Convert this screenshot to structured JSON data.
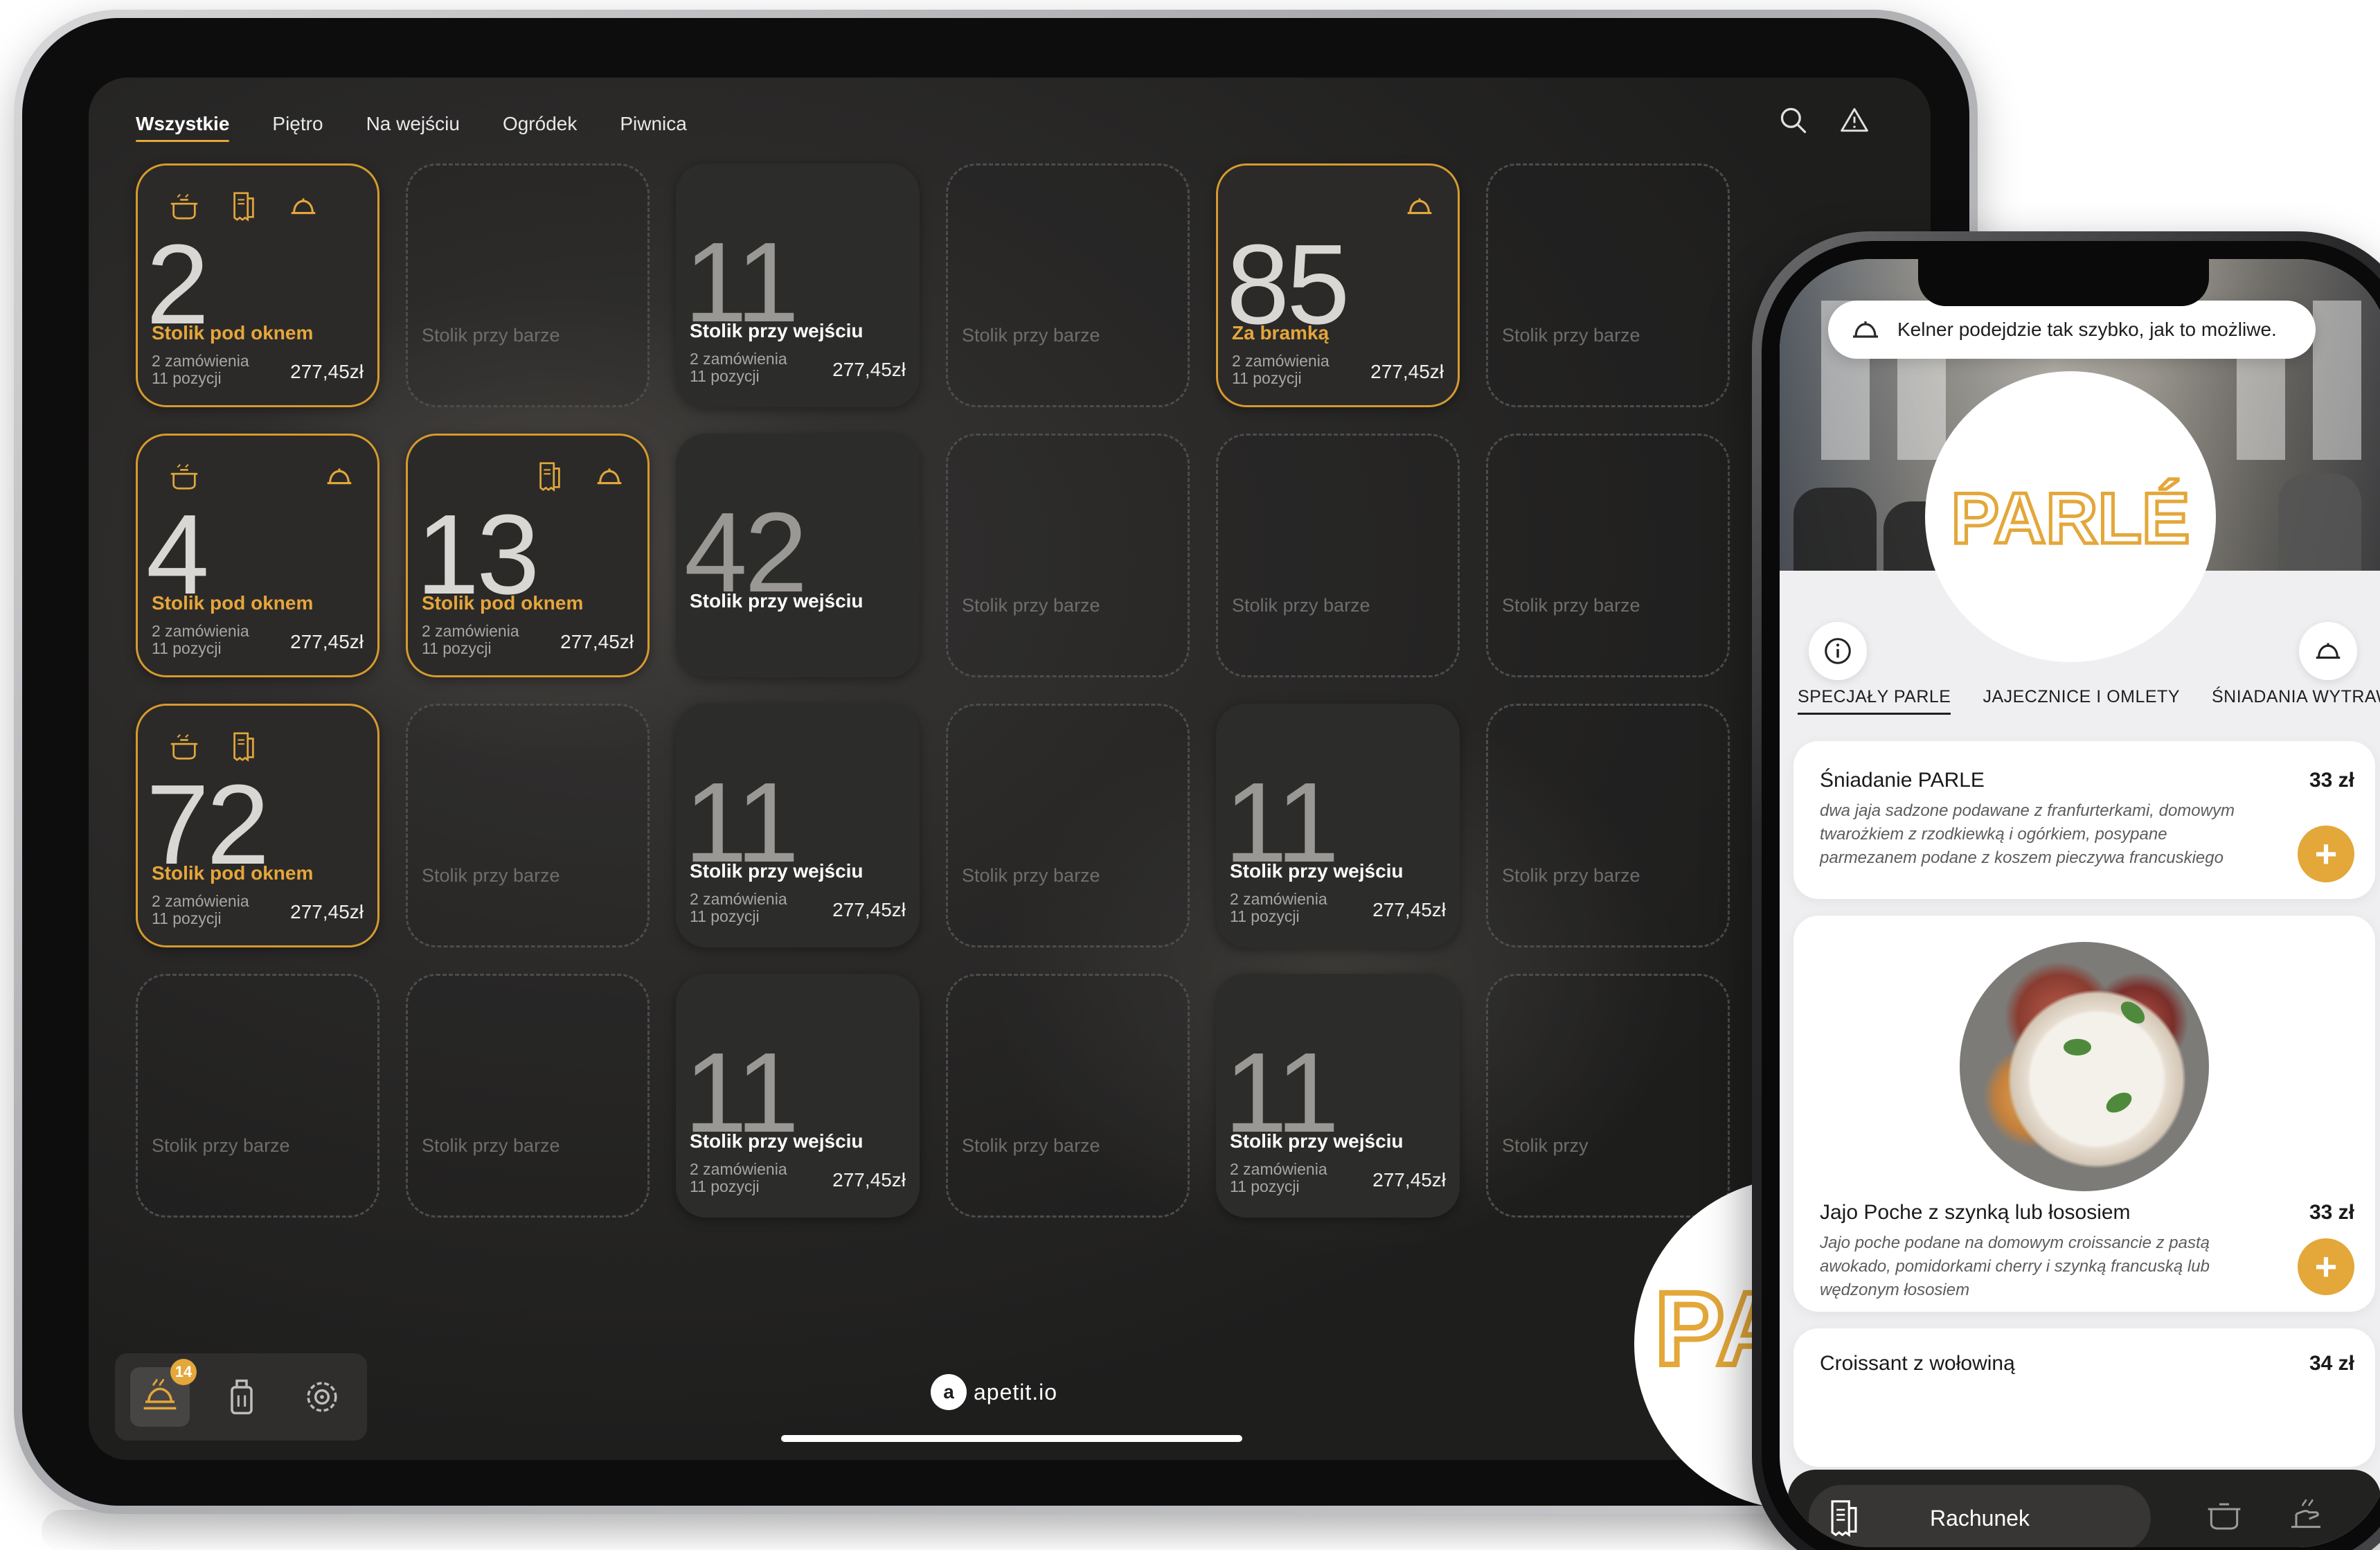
{
  "tablet": {
    "tabs": [
      "Wszystkie",
      "Piętro",
      "Na wejściu",
      "Ogródek",
      "Piwnica"
    ],
    "active_tab": "Wszystkie",
    "icons": {
      "search": "search-icon",
      "alert": "warning-icon"
    },
    "placeholder_text": "Stolik przy barze",
    "cards": [
      {
        "kind": "gold",
        "number": "2",
        "label": "Stolik pod oknem",
        "orders": "2 zamówienia",
        "items": "11 pozycji",
        "price": "277,45zł",
        "icons": [
          "pot-icon",
          "receipt-icon",
          "cloche-icon"
        ]
      },
      {
        "kind": "empty",
        "label": "Stolik przy barze"
      },
      {
        "kind": "dark",
        "number": "11",
        "label": "Stolik przy wejściu",
        "orders": "2 zamówienia",
        "items": "11 pozycji",
        "price": "277,45zł"
      },
      {
        "kind": "empty",
        "label": "Stolik przy barze"
      },
      {
        "kind": "gold",
        "number": "85",
        "label": "Za bramką",
        "orders": "2 zamówienia",
        "items": "11 pozycji",
        "price": "277,45zł",
        "icons": [
          "cloche-icon"
        ]
      },
      {
        "kind": "empty",
        "label": "Stolik przy barze"
      },
      {
        "kind": "gold",
        "number": "4",
        "label": "Stolik pod oknem",
        "orders": "2 zamówienia",
        "items": "11 pozycji",
        "price": "277,45zł",
        "icons": [
          "pot-icon",
          "cloche-icon"
        ]
      },
      {
        "kind": "gold",
        "number": "13",
        "label": "Stolik pod oknem",
        "orders": "2 zamówienia",
        "items": "11 pozycji",
        "price": "277,45zł",
        "icons": [
          "receipt-icon",
          "cloche-icon"
        ]
      },
      {
        "kind": "dark",
        "number": "42",
        "label": "Stolik przy wejściu"
      },
      {
        "kind": "empty",
        "label": "Stolik przy barze"
      },
      {
        "kind": "empty",
        "label": "Stolik przy barze"
      },
      {
        "kind": "empty",
        "label": "Stolik przy barze"
      },
      {
        "kind": "gold",
        "number": "72",
        "label": "Stolik pod oknem",
        "orders": "2 zamówienia",
        "items": "11 pozycji",
        "price": "277,45zł",
        "icons": [
          "pot-icon",
          "receipt-icon"
        ]
      },
      {
        "kind": "empty",
        "label": "Stolik przy barze"
      },
      {
        "kind": "dark",
        "number": "11",
        "label": "Stolik przy wejściu",
        "orders": "2 zamówienia",
        "items": "11 pozycji",
        "price": "277,45zł"
      },
      {
        "kind": "empty",
        "label": "Stolik przy barze"
      },
      {
        "kind": "dark",
        "number": "11",
        "label": "Stolik przy wejściu",
        "orders": "2 zamówienia",
        "items": "11 pozycji",
        "price": "277,45zł"
      },
      {
        "kind": "empty",
        "label": "Stolik przy barze"
      },
      {
        "kind": "empty",
        "label": "Stolik przy barze"
      },
      {
        "kind": "empty",
        "label": "Stolik przy barze"
      },
      {
        "kind": "dark",
        "number": "11",
        "label": "Stolik przy wejściu",
        "orders": "2 zamówienia",
        "items": "11 pozycji",
        "price": "277,45zł"
      },
      {
        "kind": "empty",
        "label": "Stolik przy barze"
      },
      {
        "kind": "dark",
        "number": "11",
        "label": "Stolik przy wejściu",
        "orders": "2 zamówienia",
        "items": "11 pozycji",
        "price": "277,45zł"
      },
      {
        "kind": "empty",
        "label": "Stolik przy"
      }
    ],
    "dock": {
      "badge": "14",
      "buttons": [
        "orders-icon",
        "drinks-icon",
        "settings-icon"
      ]
    },
    "brand": {
      "mark": "a",
      "name": "apetit.io"
    },
    "corner_logo_text": "PA"
  },
  "phone": {
    "toast": "Kelner podejdzie tak szybko, jak to możliwe.",
    "logo_text": "PARLÉ",
    "categories": [
      "SPECJAŁY PARLE",
      "JAJECZNICE I OMLETY",
      "ŚNIADANIA WYTRAWNE"
    ],
    "active_category": "SPECJAŁY PARLE",
    "menu": [
      {
        "name": "Śniadanie PARLE",
        "price": "33 zł",
        "desc": "dwa jaja sadzone podawane z franfurterkami, domowym twarożkiem z rzodkiewką i ogórkiem, posypane parmezanem podane z koszem pieczywa francuskiego"
      },
      {
        "name": "Jajo Poche z szynką lub łososiem",
        "price": "33 zł",
        "desc": "Jajo poche podane na domowym croissancie z pastą awokado, pomidorkami cherry i szynką francuską lub wędzonym łososiem"
      },
      {
        "name": "Croissant z wołowiną",
        "price": "34 zł"
      }
    ],
    "plus_label": "+",
    "bill_label": "Rachunek"
  },
  "colors": {
    "accent": "#e3a73a",
    "dark_card": "#2c2c2b",
    "gold_border": "#d59a2e"
  }
}
